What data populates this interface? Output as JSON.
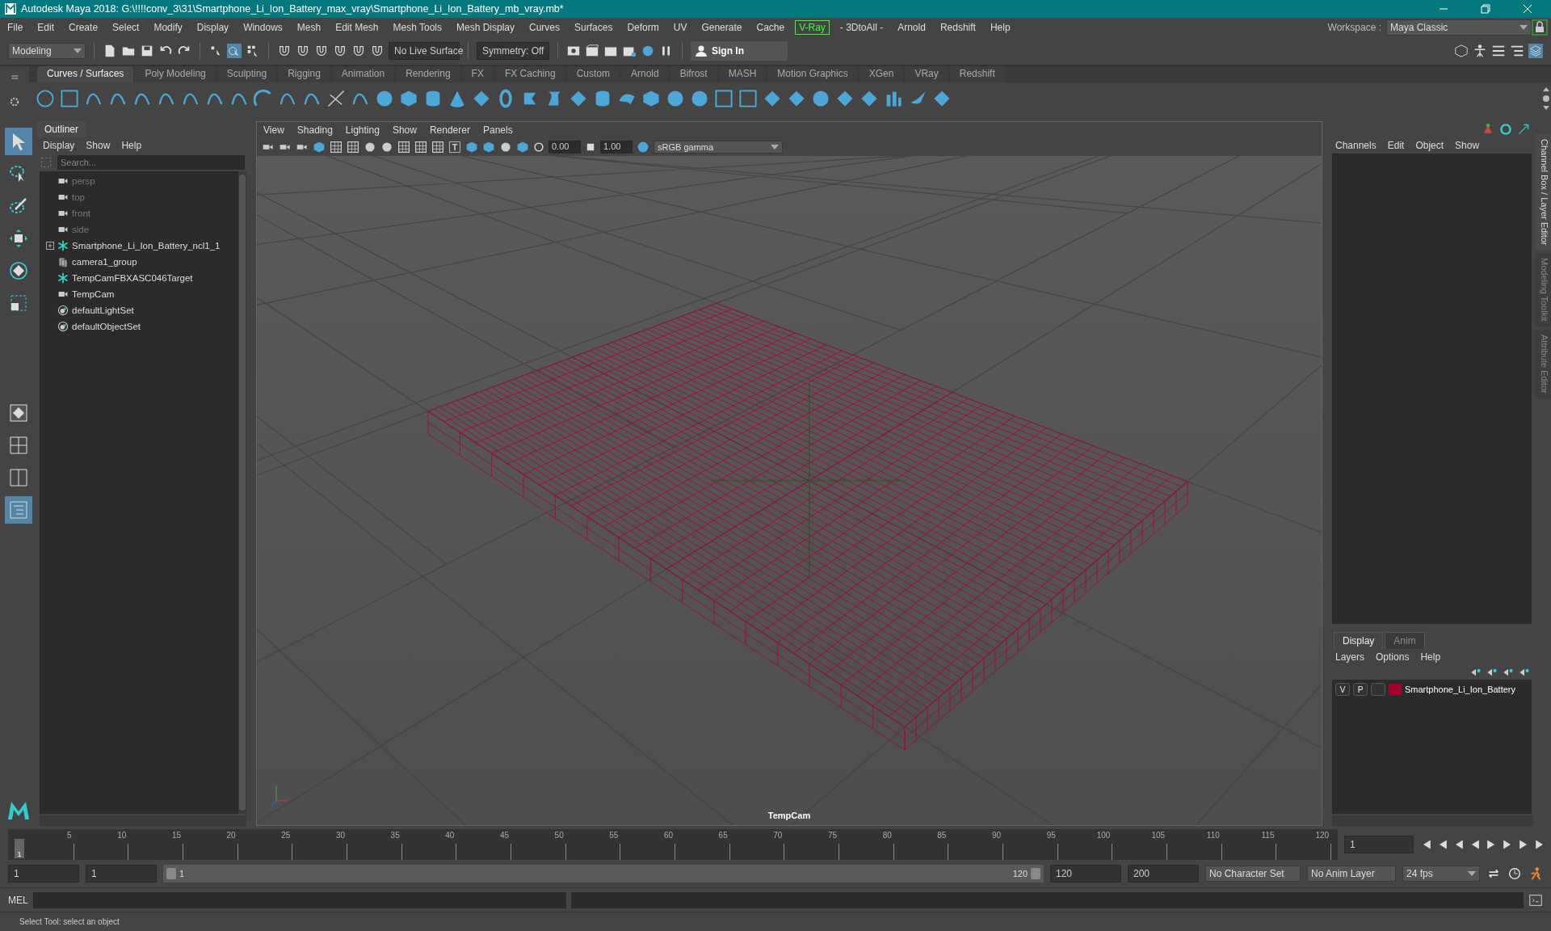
{
  "window": {
    "title": "Autodesk Maya 2018: G:\\!!!!conv_3\\31\\Smartphone_Li_Ion_Battery_max_vray\\Smartphone_Li_Ion_Battery_mb_vray.mb*"
  },
  "menu_bar": [
    {
      "label": "File",
      "highlighted": false
    },
    {
      "label": "Edit",
      "highlighted": false
    },
    {
      "label": "Create",
      "highlighted": false
    },
    {
      "label": "Select",
      "highlighted": false
    },
    {
      "label": "Modify",
      "highlighted": false
    },
    {
      "label": "Display",
      "highlighted": false
    },
    {
      "label": "Windows",
      "highlighted": false
    },
    {
      "label": "Mesh",
      "highlighted": false
    },
    {
      "label": "Edit Mesh",
      "highlighted": false
    },
    {
      "label": "Mesh Tools",
      "highlighted": false
    },
    {
      "label": "Mesh Display",
      "highlighted": false
    },
    {
      "label": "Curves",
      "highlighted": false
    },
    {
      "label": "Surfaces",
      "highlighted": false
    },
    {
      "label": "Deform",
      "highlighted": false
    },
    {
      "label": "UV",
      "highlighted": false
    },
    {
      "label": "Generate",
      "highlighted": false
    },
    {
      "label": "Cache",
      "highlighted": false
    },
    {
      "label": "V-Ray",
      "highlighted": true
    },
    {
      "label": "- 3DtoAll -",
      "highlighted": false
    },
    {
      "label": "Arnold",
      "highlighted": false
    },
    {
      "label": "Redshift",
      "highlighted": false
    },
    {
      "label": "Help",
      "highlighted": false
    }
  ],
  "workspace": {
    "label": "Workspace :",
    "value": "Maya Classic"
  },
  "status_line": {
    "mode": "Modeling",
    "live_surface": "No Live Surface",
    "symmetry": "Symmetry: Off",
    "sign_in": "Sign In"
  },
  "shelf_tabs": [
    {
      "label": "Curves / Surfaces",
      "selected": true
    },
    {
      "label": "Poly Modeling",
      "selected": false
    },
    {
      "label": "Sculpting",
      "selected": false
    },
    {
      "label": "Rigging",
      "selected": false
    },
    {
      "label": "Animation",
      "selected": false
    },
    {
      "label": "Rendering",
      "selected": false
    },
    {
      "label": "FX",
      "selected": false
    },
    {
      "label": "FX Caching",
      "selected": false
    },
    {
      "label": "Custom",
      "selected": false
    },
    {
      "label": "Arnold",
      "selected": false
    },
    {
      "label": "Bifrost",
      "selected": false
    },
    {
      "label": "MASH",
      "selected": false
    },
    {
      "label": "Motion Graphics",
      "selected": false
    },
    {
      "label": "XGen",
      "selected": false
    },
    {
      "label": "VRay",
      "selected": false
    },
    {
      "label": "Redshift",
      "selected": false
    }
  ],
  "outliner": {
    "title": "Outliner",
    "menu": [
      "Display",
      "Show",
      "Help"
    ],
    "search": {
      "placeholder": "Search..."
    },
    "items": [
      {
        "label": "persp",
        "kind": "camera",
        "dimmed": true,
        "expandable": false
      },
      {
        "label": "top",
        "kind": "camera",
        "dimmed": true,
        "expandable": false
      },
      {
        "label": "front",
        "kind": "camera",
        "dimmed": true,
        "expandable": false
      },
      {
        "label": "side",
        "kind": "camera",
        "dimmed": true,
        "expandable": false
      },
      {
        "label": "Smartphone_Li_Ion_Battery_ncl1_1",
        "kind": "locator",
        "dimmed": false,
        "expandable": true
      },
      {
        "label": "camera1_group",
        "kind": "group",
        "dimmed": false,
        "expandable": false
      },
      {
        "label": "TempCamFBXASC046Target",
        "kind": "locator",
        "dimmed": false,
        "expandable": false
      },
      {
        "label": "TempCam",
        "kind": "camera",
        "dimmed": false,
        "expandable": false
      },
      {
        "label": "defaultLightSet",
        "kind": "set",
        "dimmed": false,
        "expandable": false
      },
      {
        "label": "defaultObjectSet",
        "kind": "set",
        "dimmed": false,
        "expandable": false
      }
    ]
  },
  "viewport": {
    "menu": [
      "View",
      "Shading",
      "Lighting",
      "Show",
      "Renderer",
      "Panels"
    ],
    "exposure": "0.00",
    "gamma": "1.00",
    "color_space": "sRGB gamma",
    "camera": "TempCam"
  },
  "channel_box": {
    "menu": [
      "Channels",
      "Edit",
      "Object",
      "Show"
    ]
  },
  "side_tabs": [
    {
      "label": "Channel Box / Layer Editor",
      "selected": true
    },
    {
      "label": "Modeling Toolkit",
      "selected": false
    },
    {
      "label": "Attribute Editor",
      "selected": false
    }
  ],
  "layer_editor": {
    "tabs": [
      {
        "label": "Display",
        "selected": true
      },
      {
        "label": "Anim",
        "selected": false
      }
    ],
    "menu": [
      "Layers",
      "Options",
      "Help"
    ],
    "layers": [
      {
        "visibility": "V",
        "playback": "P",
        "name": "Smartphone_Li_Ion_Battery",
        "color": "#a0002a"
      }
    ]
  },
  "timeline": {
    "ticks": [
      "5",
      "10",
      "15",
      "20",
      "25",
      "30",
      "35",
      "40",
      "45",
      "50",
      "55",
      "60",
      "65",
      "70",
      "75",
      "80",
      "85",
      "90",
      "95",
      "100",
      "105",
      "110",
      "115",
      "120"
    ],
    "current_frame": "1",
    "level": 0,
    "current_frame_field": "1"
  },
  "range": {
    "start": "1",
    "playback_start": "1",
    "slider_start": "1",
    "slider_end": "120",
    "level": 1,
    "playback_end": "120",
    "end": "200",
    "character_set": "No Character Set",
    "anim_layer": "No Anim Layer",
    "fps": "24 fps"
  },
  "command_line": {
    "label": "MEL"
  },
  "help_line": "Select Tool: select an object"
}
